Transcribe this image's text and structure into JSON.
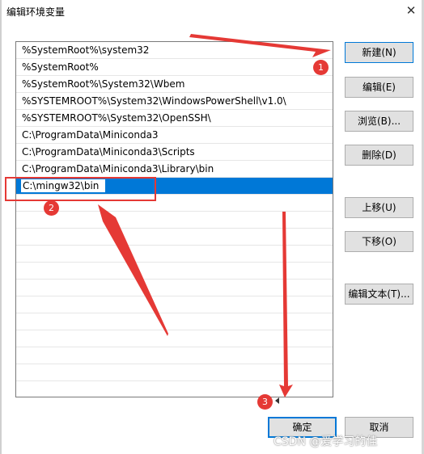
{
  "window": {
    "title": "编辑环境变量",
    "close_glyph": "✕"
  },
  "list": {
    "items": [
      "%SystemRoot%\\system32",
      "%SystemRoot%",
      "%SystemRoot%\\System32\\Wbem",
      "%SYSTEMROOT%\\System32\\WindowsPowerShell\\v1.0\\",
      "%SYSTEMROOT%\\System32\\OpenSSH\\",
      "C:\\ProgramData\\Miniconda3",
      "C:\\ProgramData\\Miniconda3\\Scripts",
      "C:\\ProgramData\\Miniconda3\\Library\\bin"
    ],
    "editing_value": "C:\\mingw32\\bin"
  },
  "buttons": {
    "new": "新建(N)",
    "edit": "编辑(E)",
    "browse": "浏览(B)...",
    "delete": "删除(D)",
    "move_up": "上移(U)",
    "move_down": "下移(O)",
    "edit_text": "编辑文本(T)...",
    "ok": "确定",
    "cancel": "取消"
  },
  "annotations": {
    "step1": "1",
    "step2": "2",
    "step3": "3",
    "color": "#e53935"
  },
  "watermark": "CSDN @爱学习的佳",
  "colors": {
    "selection": "#0078d7",
    "button_face": "#e1e1e1"
  }
}
